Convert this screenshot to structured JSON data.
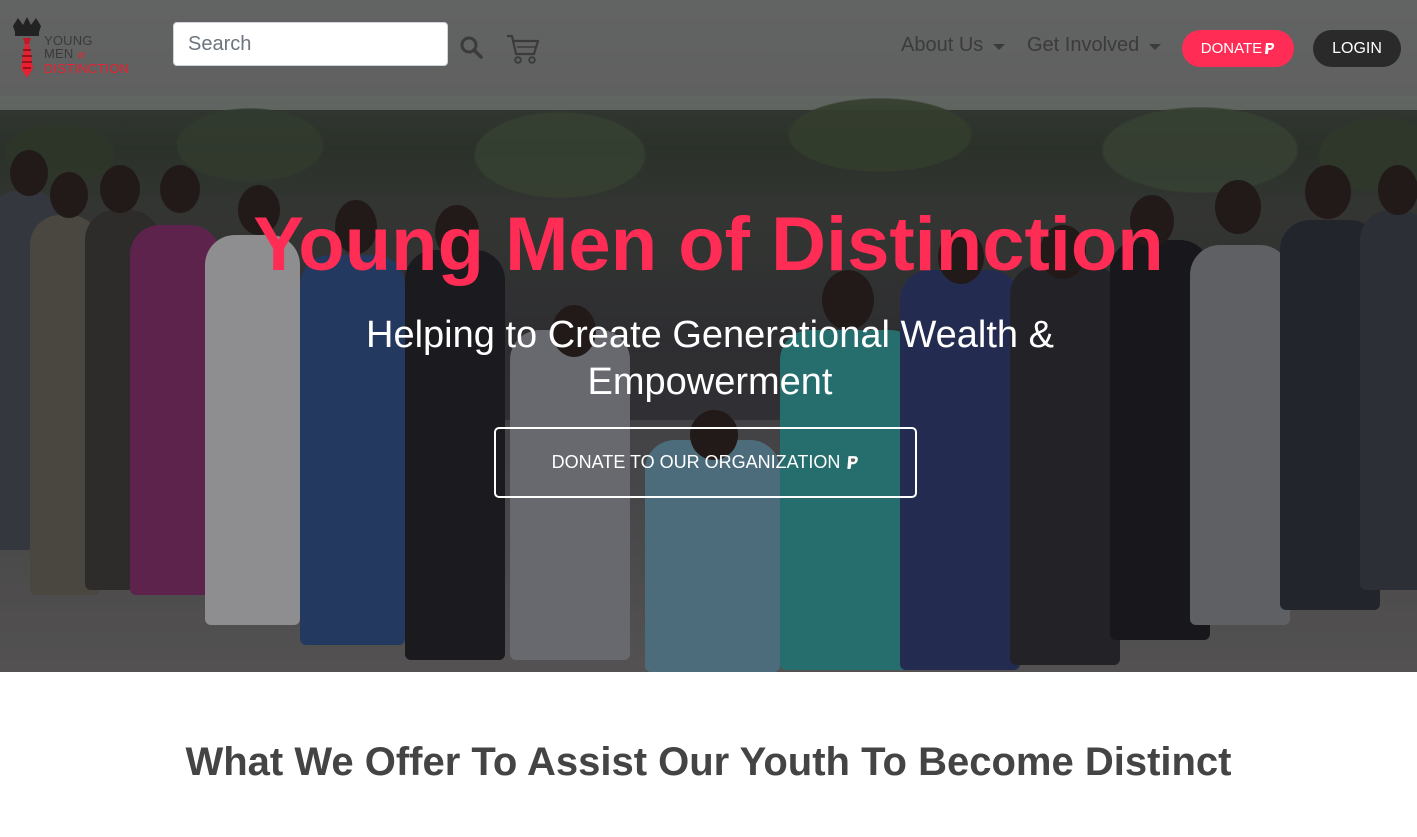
{
  "brand": {
    "logo_line1": "YOUNG",
    "logo_line2": "MEN",
    "logo_of": "of",
    "logo_line3": "DISTINCTION",
    "accent_color": "#ff2d55"
  },
  "navbar": {
    "search_placeholder": "Search",
    "search_icon": "search-icon",
    "cart_icon": "cart-icon",
    "about_label": "About Us",
    "involved_label": "Get Involved",
    "donate_label": "DONATE",
    "login_label": "LOGIN"
  },
  "hero": {
    "title": "Young Men of Distinction",
    "subtitle": "Helping to Create Generational Wealth & Empowerment",
    "cta_label": "DONATE TO OUR ORGANIZATION"
  },
  "section": {
    "title": "What We Offer To Assist Our Youth To Become Distinct"
  }
}
